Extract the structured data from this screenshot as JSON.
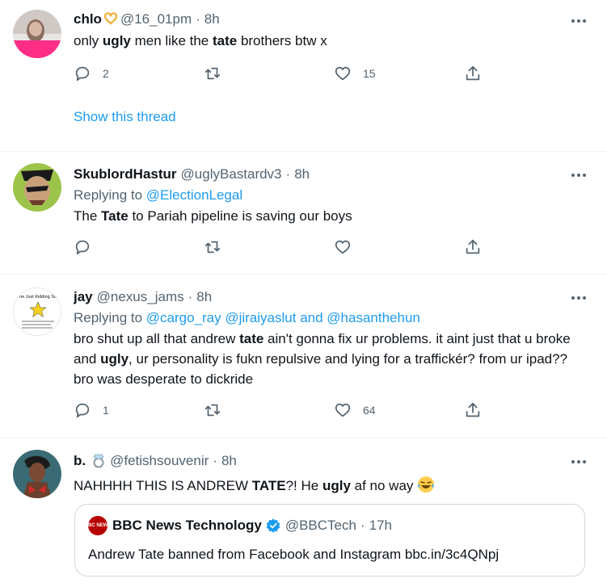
{
  "tweets": [
    {
      "name": "chlo",
      "handle": "@16_01pm",
      "time": "8h",
      "text_parts": [
        "only ",
        "ugly",
        " men like the ",
        "tate",
        " brothers btw x"
      ],
      "reply_count": "2",
      "retweet_count": "",
      "like_count": "15",
      "show_thread": "Show this thread"
    },
    {
      "name": "SkublordHastur",
      "handle": "@uglyBastardv3",
      "time": "8h",
      "replying_prefix": "Replying to ",
      "replying_to": "@ElectionLegal",
      "text_parts": [
        "The ",
        "Tate",
        " to Pariah pipeline is saving our boys"
      ],
      "reply_count": "",
      "retweet_count": "",
      "like_count": ""
    },
    {
      "name": "jay",
      "handle": "@nexus_jams",
      "time": "8h",
      "replying_prefix": "Replying to ",
      "replying_to": "@cargo_ray @jiraiyaslut and @hasanthehun",
      "avatar_title": "The Just Kidding Star",
      "text_parts": [
        "bro shut up all that andrew ",
        "tate",
        " ain't gonna fix ur problems. it aint just that u broke and ",
        "ugly",
        ", ur personality is fukn repulsive and lying for a traffickér? from ur ipad?? bro was desperate to dickride"
      ],
      "reply_count": "1",
      "retweet_count": "",
      "like_count": "64"
    },
    {
      "name": "b.",
      "handle": "@fetishsouvenir",
      "time": "8h",
      "text_parts": [
        "NAHHHH THIS IS ANDREW ",
        "TATE",
        "?! He ",
        "ugly",
        " af no way "
      ],
      "quote": {
        "name": "BBC News Technology",
        "handle": "@BBCTech",
        "time": "17h",
        "text": "Andrew Tate banned from Facebook and Instagram bbc.in/3c4QNpj",
        "logo_text": "BBC NEWS"
      }
    }
  ],
  "separator": "·",
  "icons": {
    "reply": "reply-icon",
    "retweet": "retweet-icon",
    "like": "like-icon",
    "share": "share-icon",
    "more": "more-icon",
    "verified": "verified-badge-icon"
  },
  "colors": {
    "accent": "#1d9bf0",
    "secondary_text": "#536471",
    "border": "#eff3f4"
  }
}
